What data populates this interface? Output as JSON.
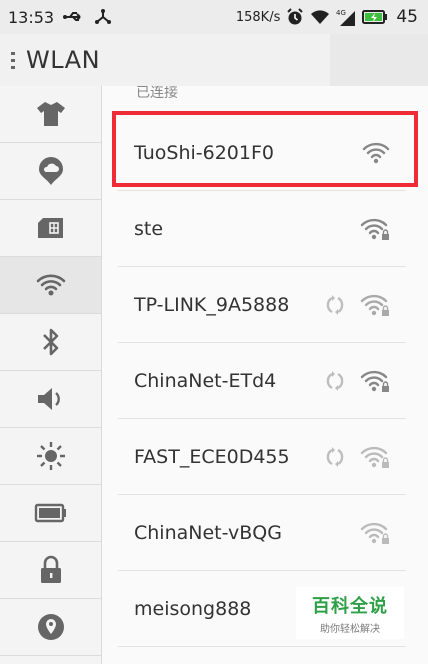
{
  "status_bar": {
    "time": "13:53",
    "speed": "158K/s",
    "battery_level": "45",
    "icons": [
      "usb-icon",
      "usb-tether-icon",
      "alarm-icon",
      "wifi-icon",
      "signal-4g-icon",
      "battery-icon"
    ]
  },
  "header": {
    "title": "WLAN"
  },
  "sidebar": {
    "items": [
      {
        "icon": "theme-shirt-icon"
      },
      {
        "icon": "cloud-icon"
      },
      {
        "icon": "sim-card-icon"
      },
      {
        "icon": "wifi-icon",
        "active": true
      },
      {
        "icon": "bluetooth-icon"
      },
      {
        "icon": "speaker-icon"
      },
      {
        "icon": "brightness-icon"
      },
      {
        "icon": "battery-icon"
      },
      {
        "icon": "lock-icon"
      },
      {
        "icon": "location-icon"
      }
    ]
  },
  "content": {
    "section_label": "已连接",
    "networks": [
      {
        "name": "TuoShi-6201F0",
        "secured": false,
        "syncing": false,
        "connected": true
      },
      {
        "name": "ste",
        "secured": true,
        "syncing": false
      },
      {
        "name": "TP-LINK_9A5888",
        "secured": true,
        "syncing": true
      },
      {
        "name": "ChinaNet-ETd4",
        "secured": true,
        "syncing": true
      },
      {
        "name": "FAST_ECE0D455",
        "secured": true,
        "syncing": true
      },
      {
        "name": "ChinaNet-vBQG",
        "secured": true,
        "syncing": false
      },
      {
        "name": "meisong888",
        "secured": true,
        "syncing": false
      }
    ]
  },
  "watermark": {
    "main": "百科全说",
    "sub": "助你轻松解决"
  },
  "colors": {
    "highlight": "#ee2b37",
    "watermark_green": "#2fa048"
  }
}
